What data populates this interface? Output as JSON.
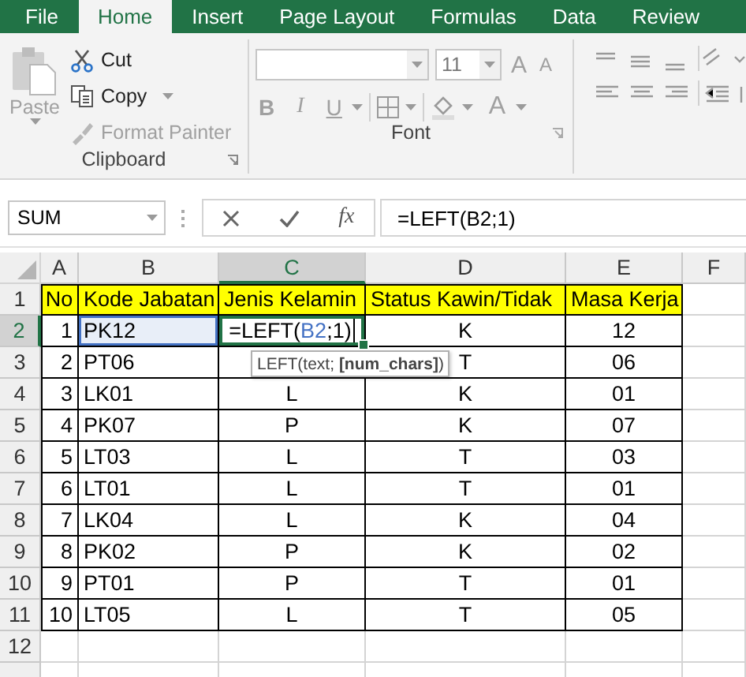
{
  "ribbon": {
    "tabs": [
      {
        "label": "File",
        "selected": false
      },
      {
        "label": "Home",
        "selected": true
      },
      {
        "label": "Insert",
        "selected": false
      },
      {
        "label": "Page Layout",
        "selected": false
      },
      {
        "label": "Formulas",
        "selected": false
      },
      {
        "label": "Data",
        "selected": false
      },
      {
        "label": "Review",
        "selected": false
      }
    ],
    "clipboard": {
      "label": "Clipboard",
      "paste": {
        "label": "Paste",
        "disabled": true
      },
      "items": [
        {
          "kind": "cut",
          "label": "Cut",
          "disabled": false
        },
        {
          "kind": "copy",
          "label": "Copy",
          "disabled": false
        },
        {
          "kind": "painter",
          "label": "Format Painter",
          "disabled": true
        }
      ]
    },
    "font": {
      "label": "Font",
      "font_size": "11",
      "grow": "A",
      "shrink": "A",
      "bold": "B",
      "italic": "I",
      "underline": "U",
      "font_color": "A",
      "disabled": true
    }
  },
  "formula_bar": {
    "name_box": "SUM",
    "fx": "fx",
    "formula": "=LEFT(B2;1)"
  },
  "sheet": {
    "columns": [
      {
        "label": "A",
        "selected": false
      },
      {
        "label": "B",
        "selected": false
      },
      {
        "label": "C",
        "selected": true
      },
      {
        "label": "D",
        "selected": false
      },
      {
        "label": "E",
        "selected": false
      },
      {
        "label": "F",
        "selected": false
      }
    ],
    "rows": [
      {
        "label": "1",
        "selected": false,
        "kind": "header",
        "no": "No",
        "code": "Kode Jabatan",
        "gender": "Jenis Kelamin",
        "status": "Status Kawin/Tidak",
        "years": "Masa Kerja"
      },
      {
        "label": "2",
        "selected": true,
        "kind": "data",
        "no": "1",
        "code": "PK12",
        "code_referenced": true,
        "gender_edit": {
          "before": "=LEFT(",
          "ref": "B2",
          "after": ";1)"
        },
        "status": "K",
        "years": "12"
      },
      {
        "label": "3",
        "selected": false,
        "kind": "data",
        "no": "2",
        "code": "PT06",
        "status": "T",
        "years": "06"
      },
      {
        "label": "4",
        "selected": false,
        "kind": "data",
        "no": "3",
        "code": "LK01",
        "gender": "L",
        "status": "K",
        "years": "01"
      },
      {
        "label": "5",
        "selected": false,
        "kind": "data",
        "no": "4",
        "code": "PK07",
        "gender": "P",
        "status": "K",
        "years": "07"
      },
      {
        "label": "6",
        "selected": false,
        "kind": "data",
        "no": "5",
        "code": "LT03",
        "gender": "L",
        "status": "T",
        "years": "03"
      },
      {
        "label": "7",
        "selected": false,
        "kind": "data",
        "no": "6",
        "code": "LT01",
        "gender": "L",
        "status": "T",
        "years": "01"
      },
      {
        "label": "8",
        "selected": false,
        "kind": "data",
        "no": "7",
        "code": "LK04",
        "gender": "L",
        "status": "K",
        "years": "04"
      },
      {
        "label": "9",
        "selected": false,
        "kind": "data",
        "no": "8",
        "code": "PK02",
        "gender": "P",
        "status": "K",
        "years": "02"
      },
      {
        "label": "10",
        "selected": false,
        "kind": "data",
        "no": "9",
        "code": "PT01",
        "gender": "P",
        "status": "T",
        "years": "01"
      },
      {
        "label": "11",
        "selected": false,
        "kind": "data",
        "no": "10",
        "code": "LT05",
        "gender": "L",
        "status": "T",
        "years": "05"
      },
      {
        "label": "12",
        "selected": false,
        "kind": "empty"
      }
    ],
    "tooltip": "LEFT(text; **[num_chars]**)"
  }
}
